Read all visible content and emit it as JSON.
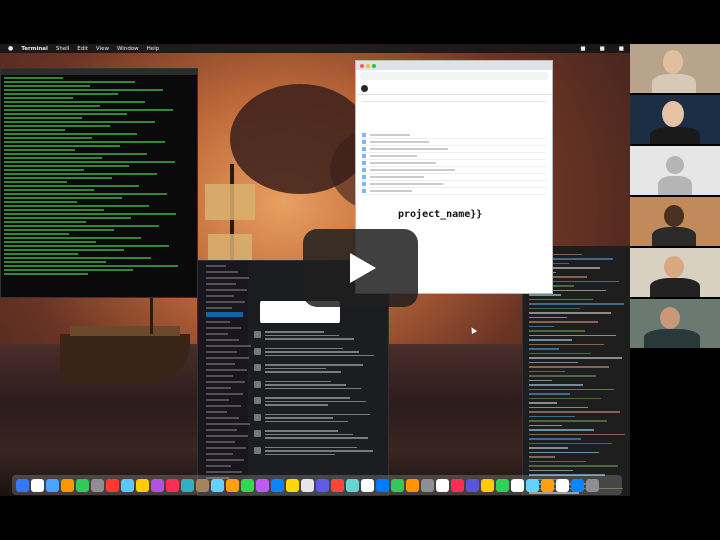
{
  "menubar": {
    "app": "Terminal",
    "items": [
      "Shell",
      "Edit",
      "View",
      "Window",
      "Help"
    ]
  },
  "browser": {
    "readme_heading": "project_name}}"
  },
  "participants": [
    "participant-1",
    "participant-2",
    "participant-3",
    "participant-4",
    "participant-5",
    "participant-6"
  ],
  "colors": {
    "terminal_text": "#3fb34a",
    "slack_active": "#1164a3",
    "play_button_bg": "#1e1e1e"
  },
  "icons": {
    "play": "play-icon",
    "apple": "apple-icon"
  }
}
